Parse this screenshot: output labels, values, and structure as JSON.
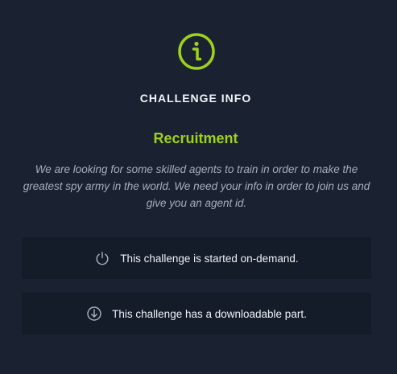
{
  "header": {
    "icon": "info-circle-icon",
    "title": "CHALLENGE INFO"
  },
  "challenge": {
    "name": "Recruitment",
    "description": "We are looking for some skilled agents to train in order to make the greatest spy army in the world. We need your info in order to join us and give you an agent id."
  },
  "features": [
    {
      "icon": "power-icon",
      "text": "This challenge is started on-demand."
    },
    {
      "icon": "download-circle-icon",
      "text": "This challenge has a downloadable part."
    }
  ],
  "colors": {
    "background": "#1a2231",
    "accent": "#9fd11a",
    "box": "#141c29",
    "text": "#eef1f5",
    "muted": "#a6aebb"
  }
}
